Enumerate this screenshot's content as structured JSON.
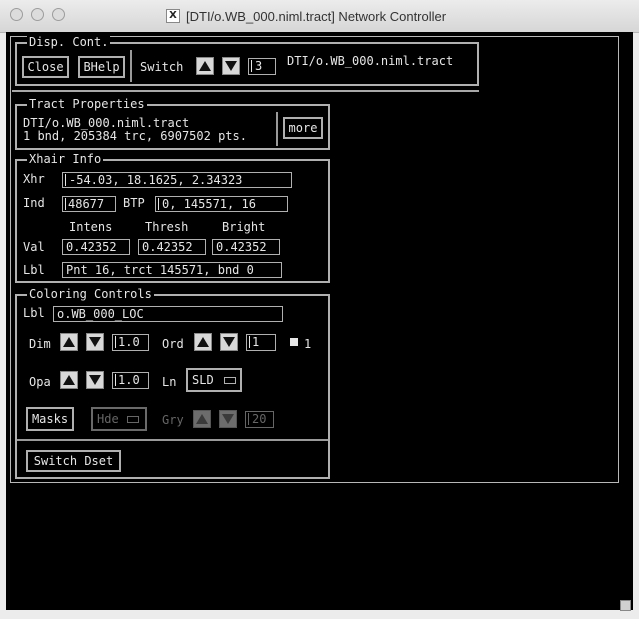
{
  "window": {
    "title": "[DTI/o.WB_000.niml.tract] Network Controller",
    "app_icon": "x11-icon"
  },
  "disp_cont": {
    "title": "Disp. Cont.",
    "close_label": "Close",
    "bhelp_label": "BHelp",
    "switch_label": "Switch",
    "switch_value": "3",
    "dataset_name": "DTI/o.WB_000.niml.tract"
  },
  "tract_properties": {
    "title": "Tract Properties",
    "line1": "DTI/o.WB_000.niml.tract",
    "line2": "1 bnd, 205384 trc, 6907502 pts.",
    "more_label": "more"
  },
  "xhair_info": {
    "title": "Xhair Info",
    "xhr_label": "Xhr",
    "xhr_value": "-54.03, 18.1625, 2.34323",
    "ind_label": "Ind",
    "ind_value": "48677",
    "btp_label": "BTP",
    "btp_value": "0, 145571, 16",
    "col_intens": "Intens",
    "col_thresh": "Thresh",
    "col_bright": "Bright",
    "val_label": "Val",
    "val_intens": "0.42352",
    "val_thresh": "0.42352",
    "val_bright": "0.42352",
    "lbl_label": "Lbl",
    "lbl_value": "Pnt 16, trct 145571, bnd 0"
  },
  "coloring_controls": {
    "title": "Coloring Controls",
    "lbl_label": "Lbl",
    "lbl_value": "o.WB_000_LOC",
    "dim_label": "Dim",
    "dim_value": "1.0",
    "ord_label": "Ord",
    "ord_value": "1",
    "ord_count": "1",
    "opa_label": "Opa",
    "opa_value": "1.0",
    "ln_label": "Ln",
    "ln_value": "SLD",
    "masks_label": "Masks",
    "hde_label": "Hde",
    "gry_label": "Gry",
    "gry_value": "20",
    "switch_dset_label": "Switch Dset"
  }
}
